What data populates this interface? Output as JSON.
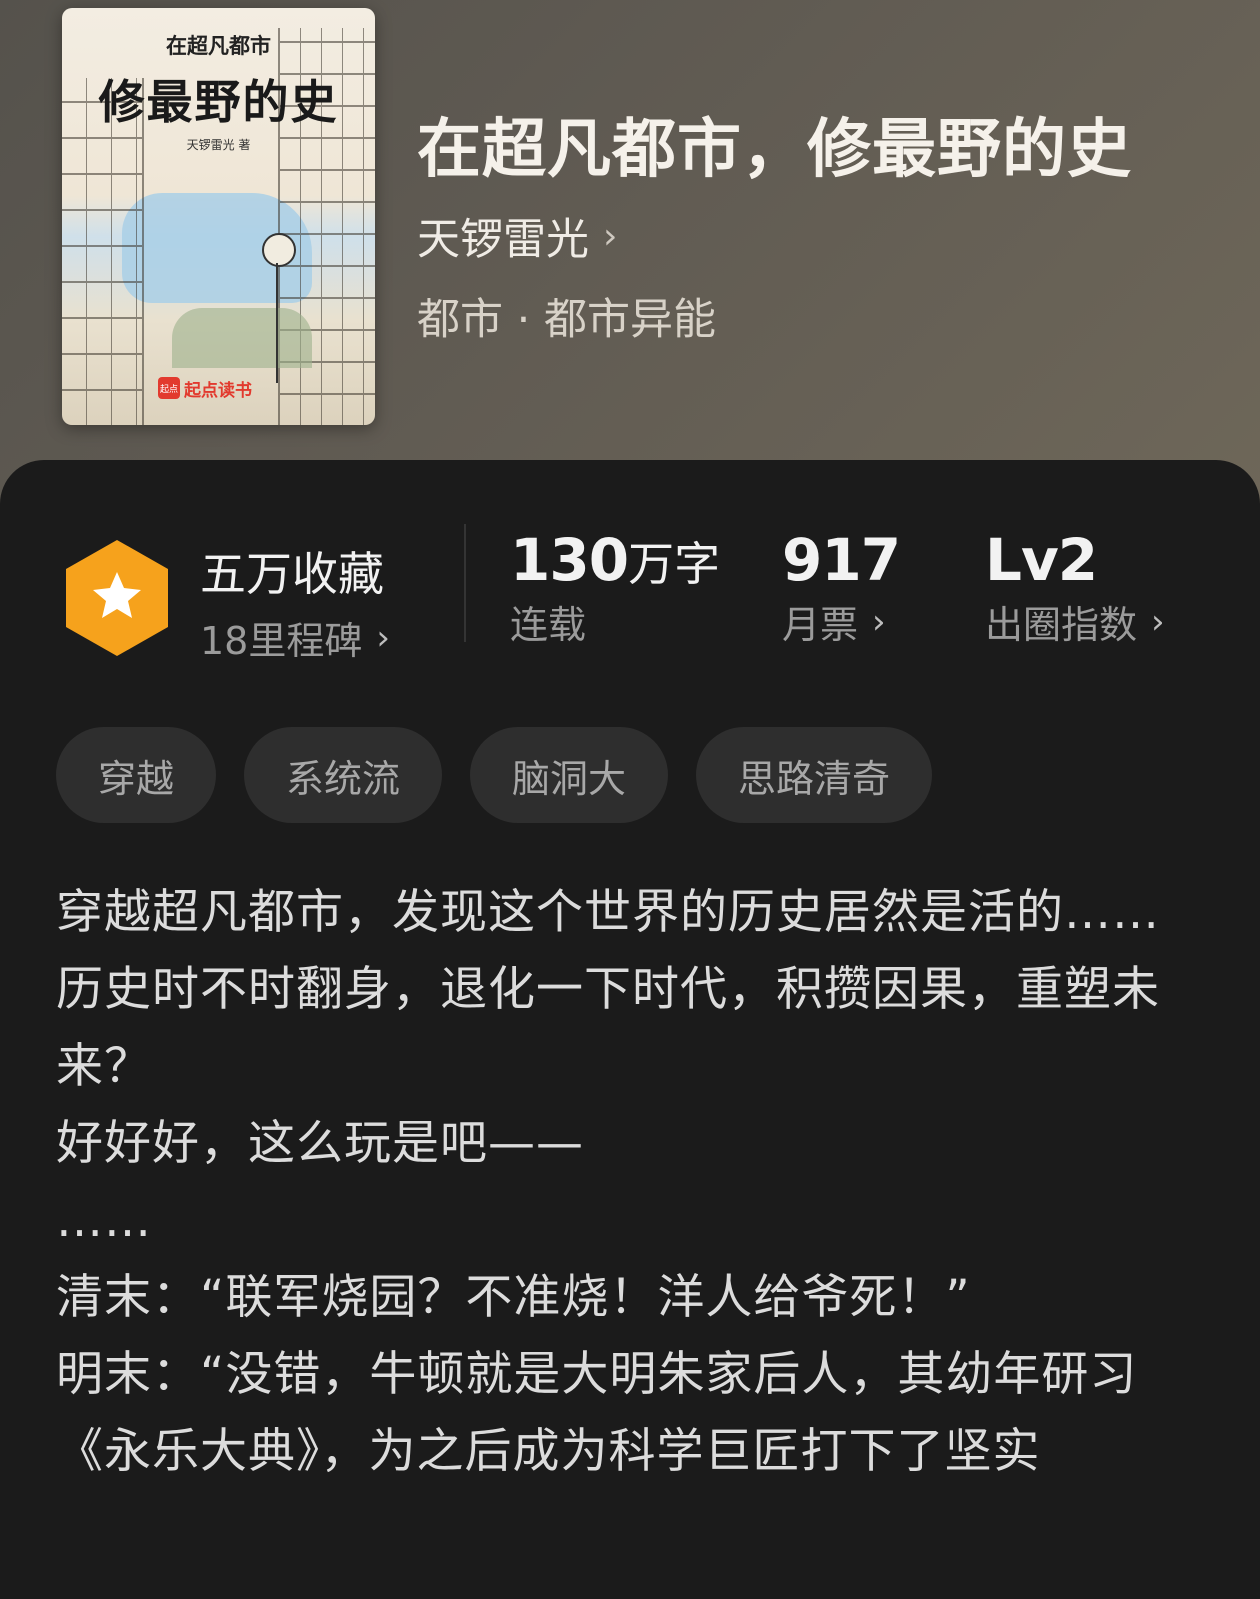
{
  "cover": {
    "small_title": "在超凡都市",
    "big_title": "修最野的史",
    "author_line": "天锣雷光 著",
    "brand_logo": "起点",
    "brand_name": "起点读书"
  },
  "book": {
    "title": "在超凡都市，修最野的史",
    "author": "天锣雷光",
    "genre": "都市 · 都市异能"
  },
  "stats": {
    "badge_icon": "star-icon",
    "collect": {
      "main": "五万收藏",
      "sub": "18里程碑"
    },
    "words": {
      "num": "130",
      "unit": "万字",
      "sub": "连载"
    },
    "tickets": {
      "num": "917",
      "sub": "月票"
    },
    "level": {
      "num": "Lv2",
      "sub": "出圈指数"
    }
  },
  "tags": [
    "穿越",
    "系统流",
    "脑洞大",
    "思路清奇"
  ],
  "description": [
    "穿越超凡都市，发现这个世界的历史居然是活的……",
    "历史时不时翻身，退化一下时代，积攒因果，重塑未来？",
    "好好好，这么玩是吧——",
    "……",
    "清末：“联军烧园？不准烧！洋人给爷死！”",
    "明末：“没错，牛顿就是大明朱家后人，其幼年研习《永乐大典》，为之后成为科学巨匠打下了坚实"
  ],
  "colors": {
    "badge_orange": "#f6a21c",
    "panel_bg": "#1b1b1b",
    "tag_bg": "#2e2e2e"
  }
}
